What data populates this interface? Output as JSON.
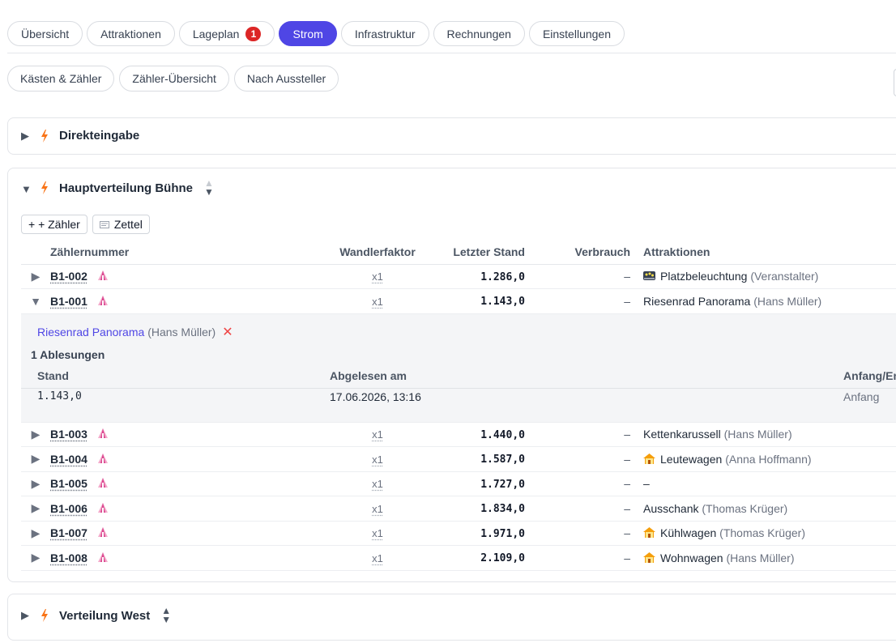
{
  "tabs": [
    {
      "label": "Übersicht"
    },
    {
      "label": "Attraktionen"
    },
    {
      "label": "Lageplan",
      "badge": "1"
    },
    {
      "label": "Strom",
      "active": true
    },
    {
      "label": "Infrastruktur"
    },
    {
      "label": "Rechnungen"
    },
    {
      "label": "Einstellungen"
    }
  ],
  "subtabs": [
    "Kästen & Zähler",
    "Zähler-Übersicht",
    "Nach Aussteller"
  ],
  "panels": {
    "direct": {
      "title": "Direkteingabe"
    },
    "main": {
      "title": "Hauptverteilung Bühne",
      "add_label": "+ + Zähler",
      "zettel_label": "Zettel",
      "columns": {
        "number": "Zählernummer",
        "factor": "Wandlerfaktor",
        "last": "Letzter Stand",
        "usage": "Verbrauch",
        "attractions": "Attraktionen"
      },
      "rows": [
        {
          "number": "B1-002",
          "factor": "x1",
          "last": "1.286,0",
          "usage": "–",
          "attraction": "Platzbeleuchtung",
          "owner": "(Veranstalter)",
          "icon": "lights-icon"
        },
        {
          "number": "B1-001",
          "factor": "x1",
          "last": "1.143,0",
          "usage": "–",
          "attraction": "Riesenrad Panorama",
          "owner": "(Hans Müller)",
          "expanded": true
        },
        {
          "number": "B1-003",
          "factor": "x1",
          "last": "1.440,0",
          "usage": "–",
          "attraction": "Kettenkarussell",
          "owner": "(Hans Müller)"
        },
        {
          "number": "B1-004",
          "factor": "x1",
          "last": "1.587,0",
          "usage": "–",
          "attraction": "Leutewagen",
          "owner": "(Anna Hoffmann)",
          "icon": "house-icon"
        },
        {
          "number": "B1-005",
          "factor": "x1",
          "last": "1.727,0",
          "usage": "–",
          "attraction": "–",
          "owner": ""
        },
        {
          "number": "B1-006",
          "factor": "x1",
          "last": "1.834,0",
          "usage": "–",
          "attraction": "Ausschank",
          "owner": "(Thomas Krüger)"
        },
        {
          "number": "B1-007",
          "factor": "x1",
          "last": "1.971,0",
          "usage": "–",
          "attraction": "Kühlwagen",
          "owner": "(Thomas Krüger)",
          "icon": "house-icon"
        },
        {
          "number": "B1-008",
          "factor": "x1",
          "last": "2.109,0",
          "usage": "–",
          "attraction": "Wohnwagen",
          "owner": "(Hans Müller)",
          "icon": "house-icon"
        }
      ],
      "detail": {
        "link": "Riesenrad Panorama",
        "owner": "(Hans Müller)",
        "remove": "✕",
        "count": "1 Ablesungen",
        "headers": {
          "stand": "Stand",
          "date": "Abgelesen am",
          "type": "Anfang/Ende"
        },
        "reading": {
          "stand": "1.143,0",
          "date": "17.06.2026, 13:16",
          "type": "Anfang"
        }
      }
    },
    "west": {
      "title": "Verteilung West"
    }
  },
  "colors": {
    "accent": "#4f46e5",
    "badge": "#dc2626",
    "bolt": "#f97316",
    "tent": "#d9468f"
  }
}
